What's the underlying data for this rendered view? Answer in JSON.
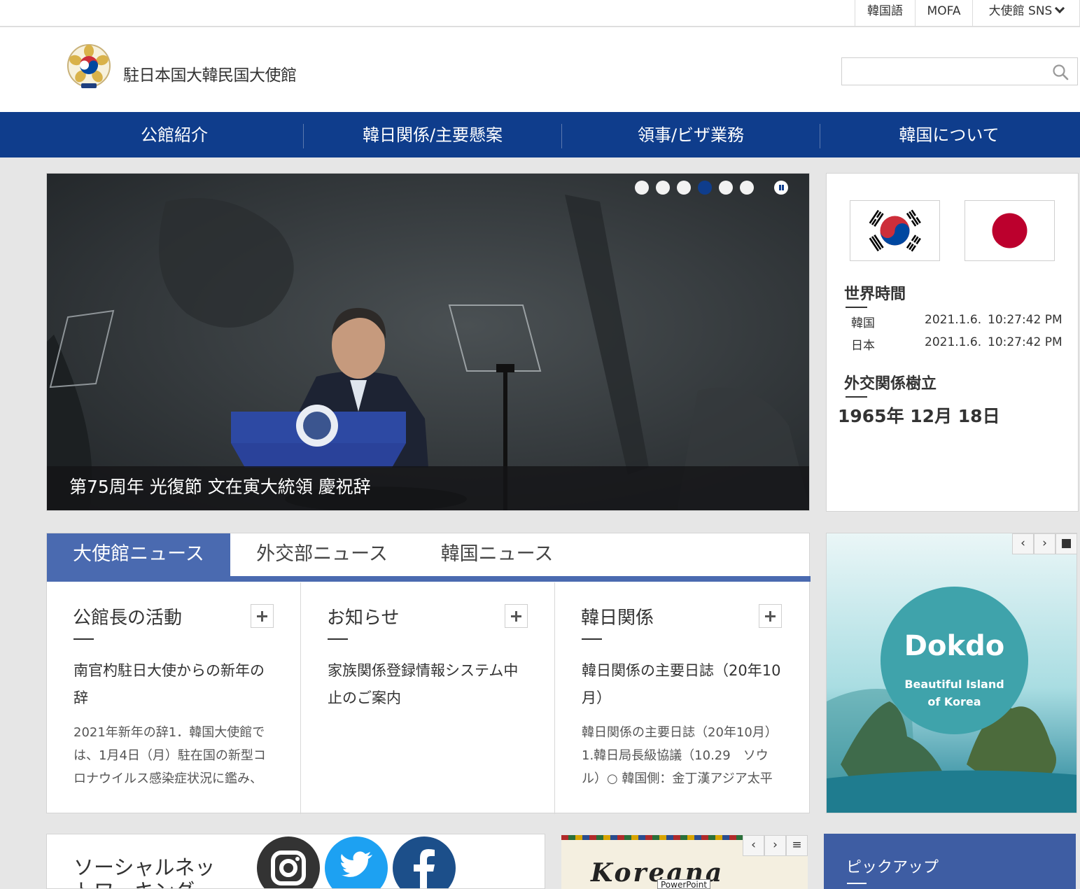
{
  "utility": {
    "lang": "韓国語",
    "mofa": "MOFA",
    "sns": "大使館 SNS"
  },
  "header": {
    "title": "駐日本国大韓民国大使館",
    "search_placeholder": ""
  },
  "nav": {
    "items": [
      {
        "label": "公館紹介"
      },
      {
        "label": "韓日関係/主要懸案"
      },
      {
        "label": "領事/ビザ業務"
      },
      {
        "label": "韓国について"
      }
    ]
  },
  "hero": {
    "caption": "第75周年 光復節 文在寅大統領 慶祝辞",
    "slide_count": 6,
    "active_slide": 4
  },
  "sideinfo": {
    "world_time_title": "世界時間",
    "zones": [
      {
        "name": "韓国",
        "date": "2021.1.6.",
        "time": "10:27:42 PM"
      },
      {
        "name": "日本",
        "date": "2021.1.6.",
        "time": "10:27:42 PM"
      }
    ],
    "relations_title": "外交関係樹立",
    "relations_date": "1965年 12月 18日"
  },
  "news": {
    "tabs": [
      {
        "label": "大使館ニュース",
        "active": true
      },
      {
        "label": "外交部ニュース",
        "active": false
      },
      {
        "label": "韓国ニュース",
        "active": false
      }
    ],
    "columns": [
      {
        "title": "公館長の活動",
        "headline": "南官杓駐日大使からの新年の辞",
        "summary": "2021年新年の辞1．韓国大使館では、1月4日（月）駐在国の新型コロナウイルス感染症状況に鑑み、"
      },
      {
        "title": "お知らせ",
        "headline": "家族関係登録情報システム中止のご案内",
        "summary": ""
      },
      {
        "title": "韓日関係",
        "headline": "韓日関係の主要日誌（20年10月）",
        "summary": "韓日関係の主要日誌（20年10月）1.韓日局長級協議（10.29　ソウル）○ 韓国側：金丁漢アジア太平"
      }
    ]
  },
  "dokdo": {
    "title": "Dokdo",
    "subtitle": "Beautiful Island of Korea",
    "controls": [
      "‹",
      "›",
      "■"
    ]
  },
  "social": {
    "title": "ソーシャルネットワーキング"
  },
  "koreana": {
    "logo": "Koreana",
    "controls": [
      "‹",
      "›",
      "≡"
    ],
    "tooltip": "PowerPoint"
  },
  "pickup": {
    "title": "ピックアップ"
  },
  "colors": {
    "nav": "#0f3d8c",
    "tab_active": "#4a6ab0",
    "pickup": "#3e5da3"
  }
}
